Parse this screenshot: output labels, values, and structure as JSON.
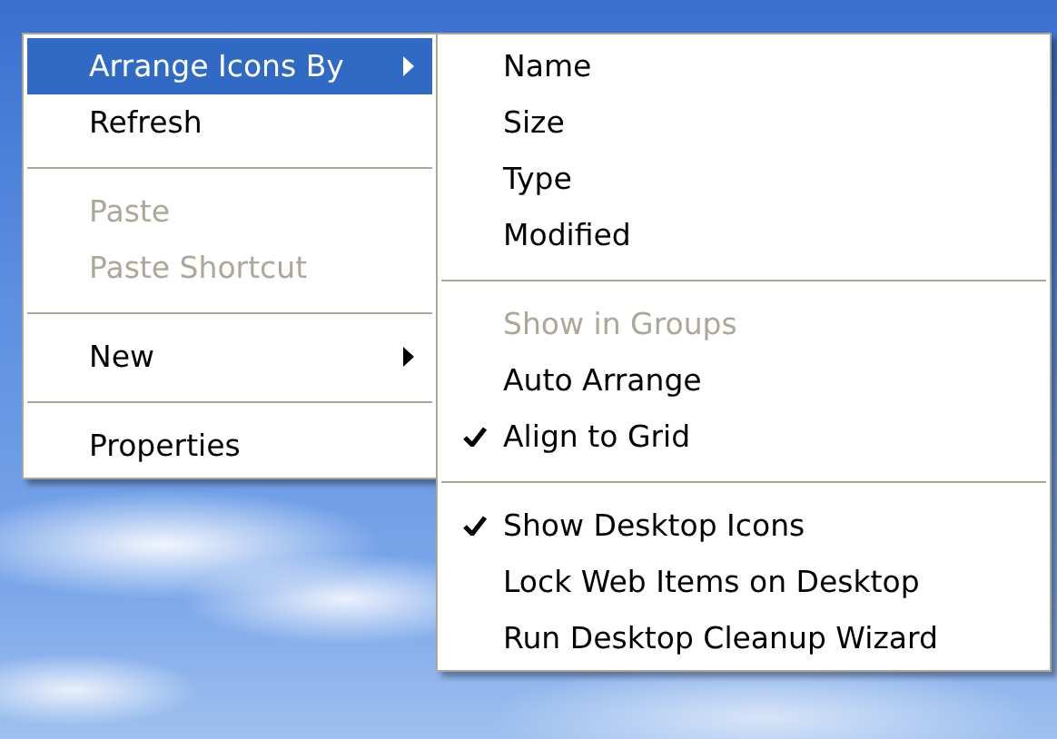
{
  "context_menu": {
    "items": [
      {
        "kind": "item",
        "label": "Arrange Icons By",
        "selected": true,
        "disabled": false,
        "submenu": true
      },
      {
        "kind": "item",
        "label": "Refresh",
        "selected": false,
        "disabled": false,
        "submenu": false
      },
      {
        "kind": "separator"
      },
      {
        "kind": "item",
        "label": "Paste",
        "selected": false,
        "disabled": true,
        "submenu": false
      },
      {
        "kind": "item",
        "label": "Paste Shortcut",
        "selected": false,
        "disabled": true,
        "submenu": false
      },
      {
        "kind": "separator"
      },
      {
        "kind": "item",
        "label": "New",
        "selected": false,
        "disabled": false,
        "submenu": true
      },
      {
        "kind": "separator"
      },
      {
        "kind": "item",
        "label": "Properties",
        "selected": false,
        "disabled": false,
        "submenu": false
      }
    ]
  },
  "submenu": {
    "items": [
      {
        "kind": "item",
        "label": "Name",
        "selected": false,
        "disabled": false,
        "checked": false
      },
      {
        "kind": "item",
        "label": "Size",
        "selected": false,
        "disabled": false,
        "checked": false
      },
      {
        "kind": "item",
        "label": "Type",
        "selected": false,
        "disabled": false,
        "checked": false
      },
      {
        "kind": "item",
        "label": "Modified",
        "selected": false,
        "disabled": false,
        "checked": false
      },
      {
        "kind": "separator"
      },
      {
        "kind": "item",
        "label": "Show in Groups",
        "selected": false,
        "disabled": true,
        "checked": false
      },
      {
        "kind": "item",
        "label": "Auto Arrange",
        "selected": false,
        "disabled": false,
        "checked": false
      },
      {
        "kind": "item",
        "label": "Align to Grid",
        "selected": false,
        "disabled": false,
        "checked": true
      },
      {
        "kind": "separator"
      },
      {
        "kind": "item",
        "label": "Show Desktop Icons",
        "selected": false,
        "disabled": false,
        "checked": true
      },
      {
        "kind": "item",
        "label": "Lock Web Items on Desktop",
        "selected": false,
        "disabled": false,
        "checked": false
      },
      {
        "kind": "item",
        "label": "Run Desktop Cleanup Wizard",
        "selected": false,
        "disabled": false,
        "checked": false
      }
    ]
  }
}
